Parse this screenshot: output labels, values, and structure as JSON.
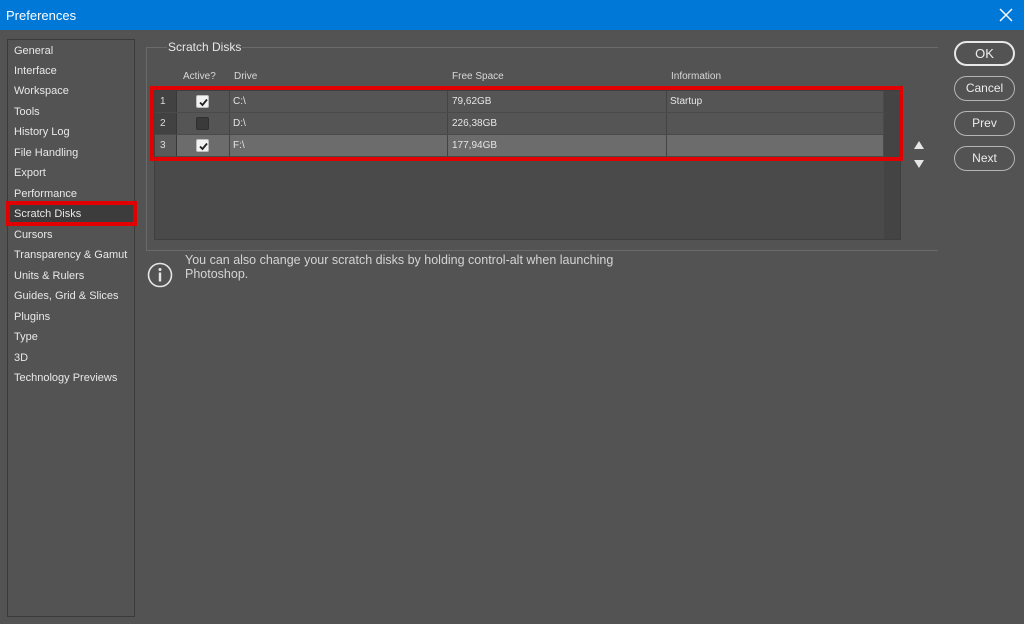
{
  "window": {
    "title": "Preferences"
  },
  "sidebar": {
    "items": [
      {
        "label": "General"
      },
      {
        "label": "Interface"
      },
      {
        "label": "Workspace"
      },
      {
        "label": "Tools"
      },
      {
        "label": "History Log"
      },
      {
        "label": "File Handling"
      },
      {
        "label": "Export"
      },
      {
        "label": "Performance"
      },
      {
        "label": "Scratch Disks"
      },
      {
        "label": "Cursors"
      },
      {
        "label": "Transparency & Gamut"
      },
      {
        "label": "Units & Rulers"
      },
      {
        "label": "Guides, Grid & Slices"
      },
      {
        "label": "Plugins"
      },
      {
        "label": "Type"
      },
      {
        "label": "3D"
      },
      {
        "label": "Technology Previews"
      }
    ],
    "selected": "Scratch Disks"
  },
  "scratch": {
    "group_title": "Scratch Disks",
    "columns": {
      "active": "Active?",
      "drive": "Drive",
      "free_space": "Free Space",
      "information": "Information"
    },
    "rows": [
      {
        "index": "1",
        "active": true,
        "drive": "C:\\",
        "free_space": "79,62GB",
        "information": "Startup"
      },
      {
        "index": "2",
        "active": false,
        "drive": "D:\\",
        "free_space": "226,38GB",
        "information": ""
      },
      {
        "index": "3",
        "active": true,
        "drive": "F:\\",
        "free_space": "177,94GB",
        "information": ""
      }
    ],
    "selected_row": "3",
    "info_text": "You can also change your scratch disks by holding control-alt when launching Photoshop."
  },
  "buttons": {
    "ok": "OK",
    "cancel": "Cancel",
    "prev": "Prev",
    "next": "Next"
  },
  "icons": {
    "close": "close-icon",
    "move_up": "triangle-up-icon",
    "move_down": "triangle-down-icon",
    "info": "info-circle-icon",
    "check": "checkmark-icon"
  },
  "colors": {
    "titlebar": "#0078d7",
    "background": "#535353",
    "highlight": "#e00000"
  }
}
